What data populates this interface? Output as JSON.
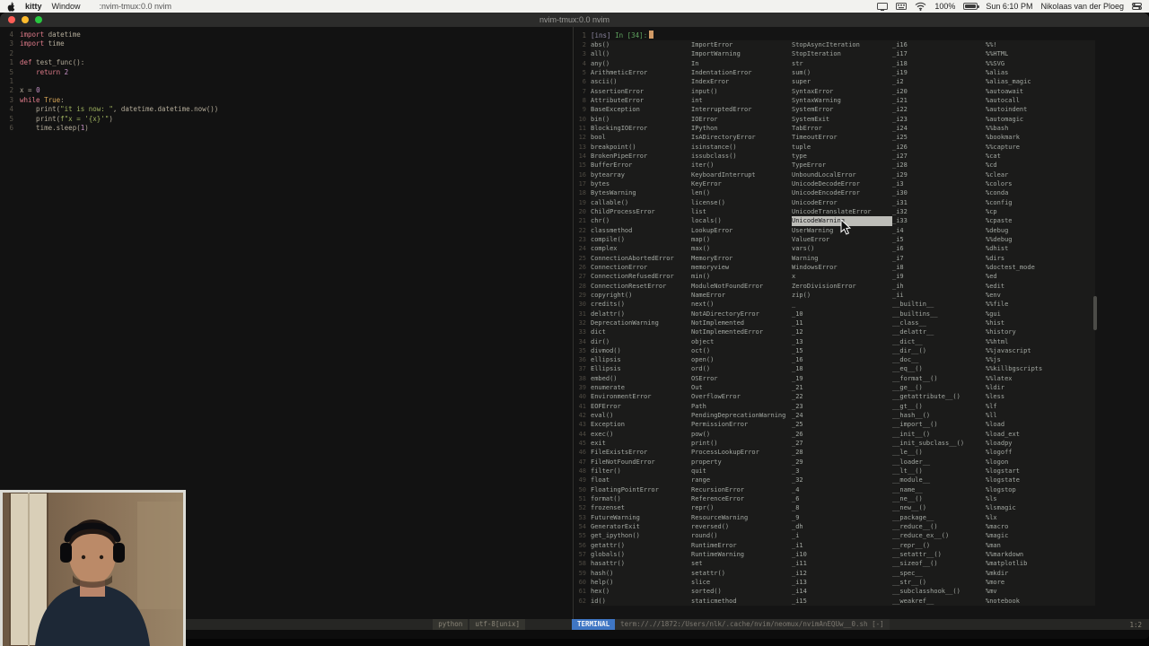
{
  "colors": {
    "accent_blue": "#3f76c4",
    "cursor": "#d19a66",
    "prompt_green": "#5fa35f",
    "badge_bg": "#3f76c4"
  },
  "menu_bar": {
    "apple_icon": "apple-logo",
    "menus": [
      "kitty",
      "Window"
    ],
    "window_menu_title": ":nvim-tmux:0.0 nvim",
    "status_right": {
      "battery_pct": "100%",
      "clock": "Sun 6:10 PM",
      "user": "Nikolaas van der Ploeg"
    }
  },
  "window": {
    "title": "nvim-tmux:0.0 nvim"
  },
  "editor": {
    "lines": [
      {
        "n": "4",
        "code": "import datetime"
      },
      {
        "n": "3",
        "code": "import time"
      },
      {
        "n": "2",
        "code": ""
      },
      {
        "n": "1",
        "code": "def test_func():"
      },
      {
        "n": "5",
        "code": "    return 2"
      },
      {
        "n": "1",
        "code": ""
      },
      {
        "n": "2",
        "code": "x = 0"
      },
      {
        "n": "3",
        "code": "while True:"
      },
      {
        "n": "4",
        "code": "    print(\"it is now: \", datetime.datetime.now())"
      },
      {
        "n": "5",
        "code": "    print(f\"x = '{x}'\")"
      },
      {
        "n": "6",
        "code": "    time.sleep(1)"
      }
    ]
  },
  "terminal": {
    "prompt": {
      "mode": "[ins]",
      "label": "In [34]:"
    },
    "selected": {
      "col": 3,
      "row": 20,
      "label": "UnicodeWarning"
    },
    "completions": {
      "col1": [
        "abs()",
        "all()",
        "any()",
        "ArithmeticError",
        "ascii()",
        "AssertionError",
        "AttributeError",
        "BaseException",
        "bin()",
        "BlockingIOError",
        "bool",
        "breakpoint()",
        "BrokenPipeError",
        "BufferError",
        "bytearray",
        "bytes",
        "BytesWarning",
        "callable()",
        "ChildProcessError",
        "chr()",
        "classmethod",
        "compile()",
        "complex",
        "ConnectionAbortedError",
        "ConnectionError",
        "ConnectionRefusedError",
        "ConnectionResetError",
        "copyright()",
        "credits()",
        "delattr()",
        "DeprecationWarning",
        "dict",
        "dir()",
        "divmod()",
        "ellipsis",
        "Ellipsis",
        "embed()",
        "enumerate",
        "EnvironmentError",
        "EOFError",
        "eval()",
        "Exception",
        "exec()",
        "exit",
        "FileExistsError",
        "FileNotFoundError",
        "filter()",
        "float",
        "FloatingPointError",
        "format()",
        "frozenset",
        "FutureWarning",
        "GeneratorExit",
        "get_ipython()",
        "getattr()",
        "globals()",
        "hasattr()",
        "hash()",
        "help()",
        "hex()",
        "id()"
      ],
      "col2": [
        "ImportError",
        "ImportWarning",
        "In",
        "IndentationError",
        "IndexError",
        "input()",
        "int",
        "InterruptedError",
        "IOError",
        "IPython",
        "IsADirectoryError",
        "isinstance()",
        "issubclass()",
        "iter()",
        "KeyboardInterrupt",
        "KeyError",
        "len()",
        "license()",
        "list",
        "locals()",
        "LookupError",
        "map()",
        "max()",
        "MemoryError",
        "memoryview",
        "min()",
        "ModuleNotFoundError",
        "NameError",
        "next()",
        "NotADirectoryError",
        "NotImplemented",
        "NotImplementedError",
        "object",
        "oct()",
        "open()",
        "ord()",
        "OSError",
        "Out",
        "OverflowError",
        "Path",
        "PendingDeprecationWarning",
        "PermissionError",
        "pow()",
        "print()",
        "ProcessLookupError",
        "property",
        "quit",
        "range",
        "RecursionError",
        "ReferenceError",
        "repr()",
        "ResourceWarning",
        "reversed()",
        "round()",
        "RuntimeError",
        "RuntimeWarning",
        "set",
        "setattr()",
        "slice",
        "sorted()",
        "staticmethod"
      ],
      "col3": [
        "StopAsyncIteration",
        "StopIteration",
        "str",
        "sum()",
        "super",
        "SyntaxError",
        "SyntaxWarning",
        "SystemError",
        "SystemExit",
        "TabError",
        "TimeoutError",
        "tuple",
        "type",
        "TypeError",
        "UnboundLocalError",
        "UnicodeDecodeError",
        "UnicodeEncodeError",
        "UnicodeError",
        "UnicodeTranslateError",
        "UnicodeWarning",
        "UserWarning",
        "ValueError",
        "vars()",
        "Warning",
        "WindowsError",
        "x",
        "ZeroDivisionError",
        "zip()",
        "_",
        "_10",
        "_11",
        "_12",
        "_13",
        "_15",
        "_16",
        "_18",
        "_19",
        "_21",
        "_22",
        "_23",
        "_24",
        "_25",
        "_26",
        "_27",
        "_28",
        "_29",
        "_3",
        "_32",
        "_4",
        "_6",
        "_8",
        "_9",
        "_dh",
        "_i",
        "_i1",
        "_i10",
        "_i11",
        "_i12",
        "_i13",
        "_i14",
        "_i15"
      ],
      "col4": [
        "_i16",
        "_i17",
        "_i18",
        "_i19",
        "_i2",
        "_i20",
        "_i21",
        "_i22",
        "_i23",
        "_i24",
        "_i25",
        "_i26",
        "_i27",
        "_i28",
        "_i29",
        "_i3",
        "_i30",
        "_i31",
        "_i32",
        "_i33",
        "_i4",
        "_i5",
        "_i6",
        "_i7",
        "_i8",
        "_i9",
        "_ih",
        "_ii",
        "__builtin__",
        "__builtins__",
        "__class__",
        "__delattr__",
        "__dict__",
        "__dir__()",
        "__doc__",
        "__eq__()",
        "__format__()",
        "__ge__()",
        "__getattribute__()",
        "__gt__()",
        "__hash__()",
        "__import__()",
        "__init__()",
        "__init_subclass__()",
        "__le__()",
        "__loader__",
        "__lt__()",
        "__module__",
        "__name__",
        "__ne__()",
        "__new__()",
        "__package__",
        "__reduce__()",
        "__reduce_ex__()",
        "__repr__()",
        "__setattr__()",
        "__sizeof__()",
        "__spec__",
        "__str__()",
        "__subclasshook__()",
        "__weakref__"
      ],
      "col5": [
        "%%!",
        "%%HTML",
        "%%SVG",
        "%alias",
        "%alias_magic",
        "%autoawait",
        "%autocall",
        "%autoindent",
        "%automagic",
        "%%bash",
        "%bookmark",
        "%%capture",
        "%cat",
        "%cd",
        "%clear",
        "%colors",
        "%conda",
        "%config",
        "%cp",
        "%cpaste",
        "%debug",
        "%%debug",
        "%dhist",
        "%dirs",
        "%doctest_mode",
        "%ed",
        "%edit",
        "%env",
        "%%file",
        "%gui",
        "%hist",
        "%history",
        "%%html",
        "%%javascript",
        "%%js",
        "%%killbgscripts",
        "%%latex",
        "%ldir",
        "%less",
        "%lf",
        "%ll",
        "%load",
        "%load_ext",
        "%loadpy",
        "%logoff",
        "%logon",
        "%logstart",
        "%logstate",
        "%logstop",
        "%ls",
        "%lsmagic",
        "%lx",
        "%macro",
        "%magic",
        "%man",
        "%%markdown",
        "%matplotlib",
        "%mkdir",
        "%more",
        "%mv",
        "%notebook"
      ]
    }
  },
  "statusline": {
    "left": [
      "python",
      "utf-8[unix]"
    ],
    "badge": "TERMINAL",
    "path": "term://.//1872:/Users/nlk/.cache/nvim/neomux/nvimAnEQUw__0.sh [-]",
    "position": "1:2"
  }
}
